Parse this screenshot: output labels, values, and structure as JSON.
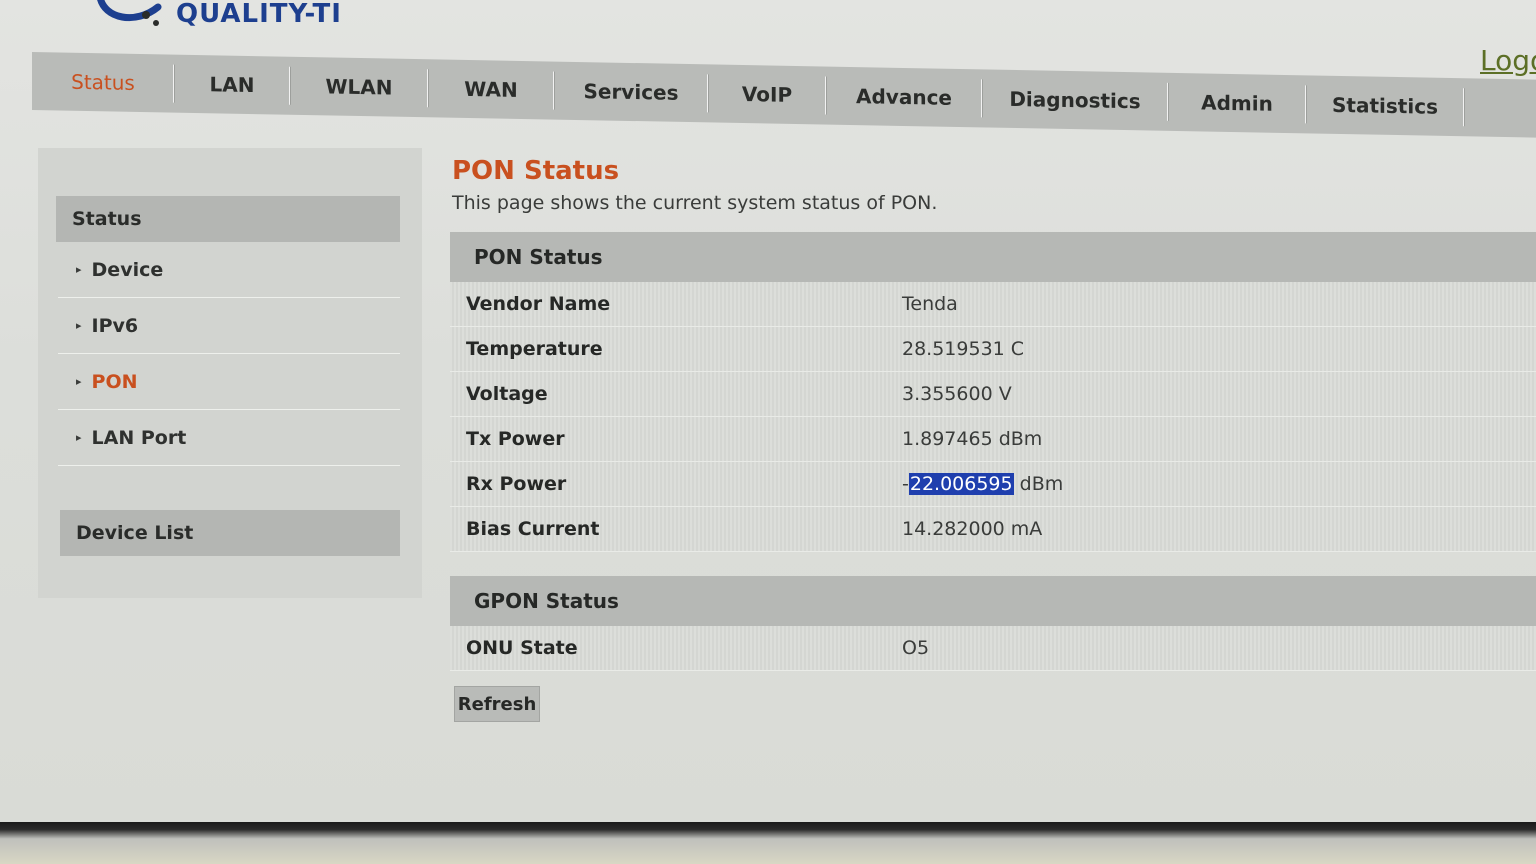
{
  "brand": {
    "logo_text": "QUALITY-TI"
  },
  "header": {
    "logout_label": "Logout"
  },
  "nav": {
    "items": [
      {
        "label": "Status",
        "active": true
      },
      {
        "label": "LAN"
      },
      {
        "label": "WLAN"
      },
      {
        "label": "WAN"
      },
      {
        "label": "Services"
      },
      {
        "label": "VoIP"
      },
      {
        "label": "Advance"
      },
      {
        "label": "Diagnostics"
      },
      {
        "label": "Admin"
      },
      {
        "label": "Statistics"
      }
    ]
  },
  "sidebar": {
    "section_title": "Status",
    "items": [
      {
        "label": "Device"
      },
      {
        "label": "IPv6"
      },
      {
        "label": "PON",
        "active": true
      },
      {
        "label": "LAN Port"
      }
    ],
    "device_list_title": "Device List"
  },
  "page": {
    "title": "PON Status",
    "description": "This page shows the current system status of PON."
  },
  "pon_status": {
    "title": "PON Status",
    "rows": [
      {
        "label": "Vendor Name",
        "value": "Tenda"
      },
      {
        "label": "Temperature",
        "value": "28.519531 C"
      },
      {
        "label": "Voltage",
        "value": "3.355600 V"
      },
      {
        "label": "Tx Power",
        "value": "1.897465 dBm"
      },
      {
        "label": "Rx Power",
        "value_prefix": "-",
        "value_selected": "22.006595",
        "value_suffix": " dBm"
      },
      {
        "label": "Bias Current",
        "value": "14.282000 mA"
      }
    ]
  },
  "gpon_status": {
    "title": "GPON Status",
    "rows": [
      {
        "label": "ONU State",
        "value": "O5"
      }
    ]
  },
  "actions": {
    "refresh_label": "Refresh"
  },
  "colors": {
    "accent": "#c9501f",
    "brand": "#1d3f8f",
    "selection": "#1f3fae"
  }
}
